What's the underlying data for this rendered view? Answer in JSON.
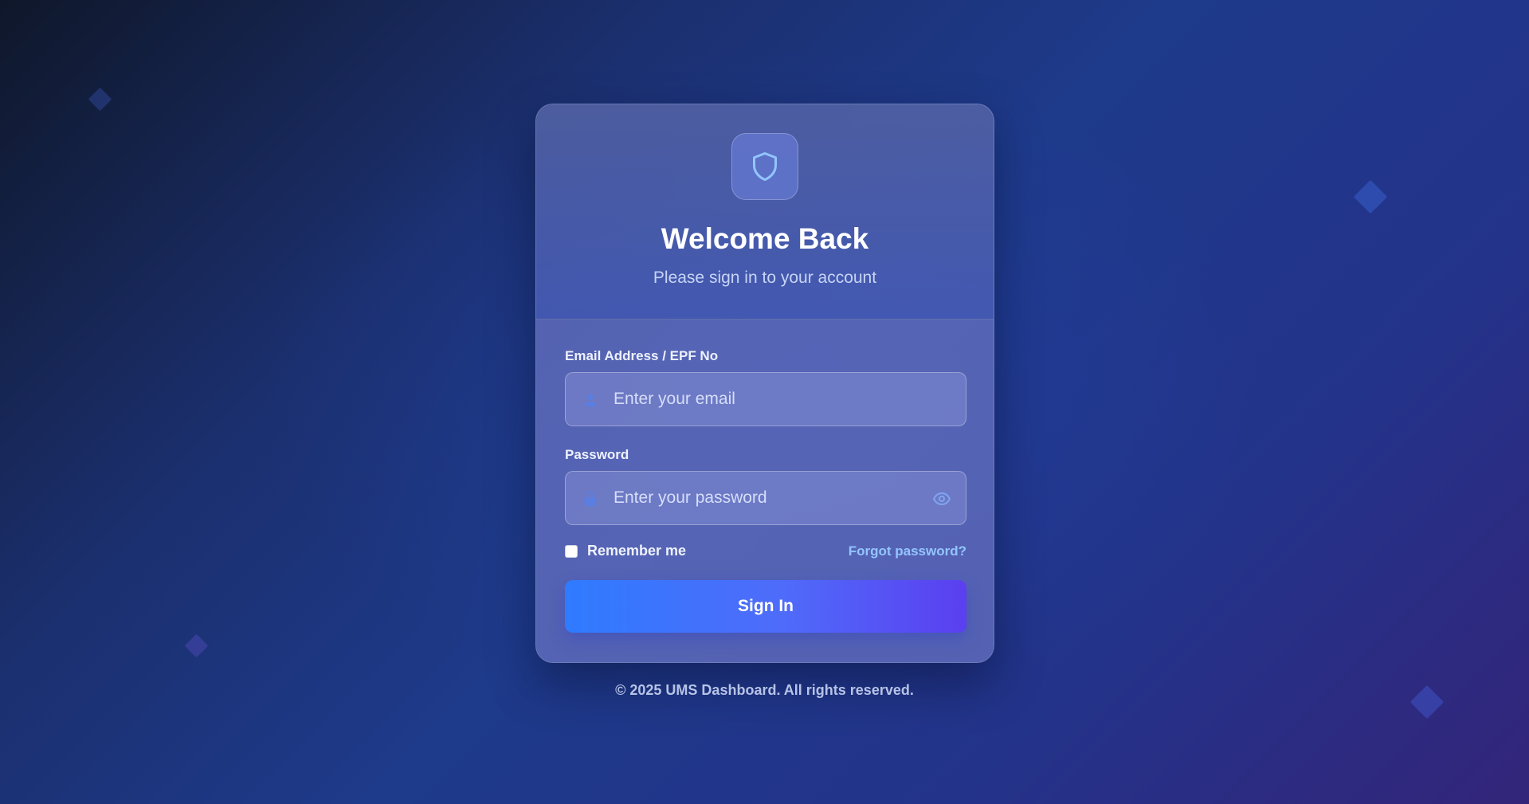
{
  "login": {
    "title": "Welcome Back",
    "subtitle": "Please sign in to your account",
    "email_label": "Email Address / EPF No",
    "email_placeholder": "Enter your email",
    "email_value": "",
    "password_label": "Password",
    "password_placeholder": "Enter your password",
    "password_value": "",
    "remember_label": "Remember me",
    "remember_checked": false,
    "forgot_label": "Forgot password?",
    "signin_label": "Sign In"
  },
  "footer": {
    "text": "© 2025 UMS Dashboard. All rights reserved."
  },
  "icons": {
    "header": "shield-icon",
    "email": "user-icon",
    "password": "lock-icon",
    "toggle": "eye-icon"
  },
  "colors": {
    "accent": "#3b82f6",
    "button_start": "#2f7bff",
    "button_end": "#5b3ff0",
    "link": "#93c5fd"
  }
}
